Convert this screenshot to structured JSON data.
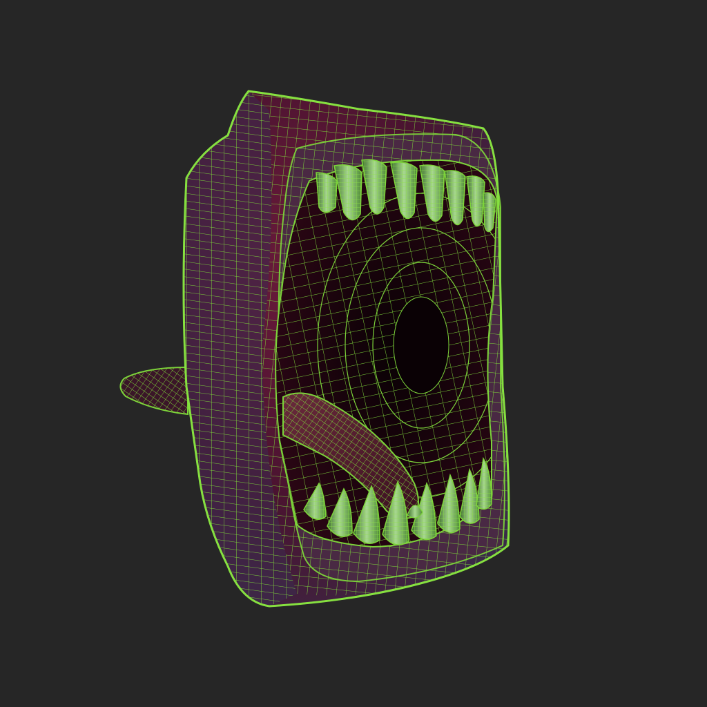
{
  "viewport": {
    "background": "#262626",
    "render_mode": "wireframe-over-shaded",
    "subject": "monster-mouth-model"
  },
  "colors": {
    "wire": "#7cd33a",
    "wire_dim": "#4f9a26",
    "flesh_dark": "#2a0a14",
    "flesh_red": "#5e1230",
    "flesh_purple": "#5a3a5c",
    "mouth_interior": "#120208",
    "tooth": "#a6d98a"
  },
  "model": {
    "upper_teeth_count": 8,
    "lower_teeth_count": 9,
    "has_tongue": true,
    "has_rear_stalk": true
  }
}
